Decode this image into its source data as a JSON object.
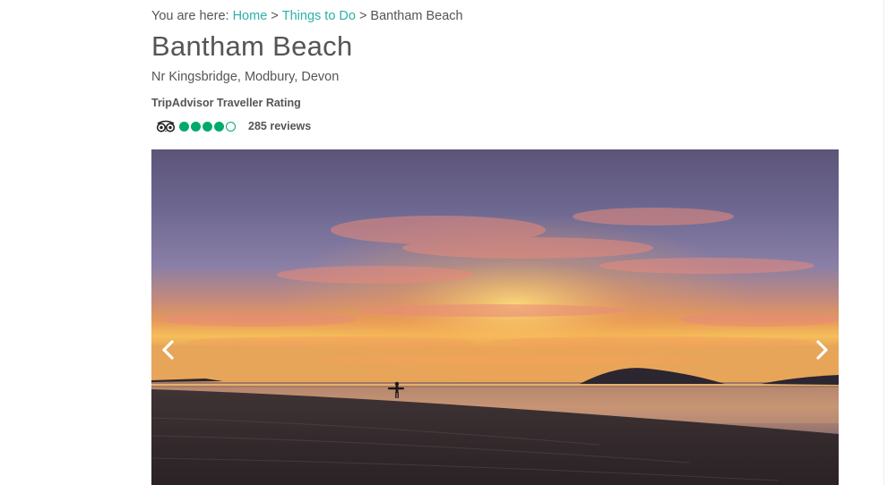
{
  "breadcrumb": {
    "prefix": "You are here:",
    "items": [
      "Home",
      "Things to Do",
      "Bantham Beach"
    ],
    "separator": ">"
  },
  "attraction": {
    "title": "Bantham Beach",
    "location": "Nr Kingsbridge, Modbury, Devon"
  },
  "rating": {
    "label": "TripAdvisor Traveller Rating",
    "provider_icon": "tripadvisor-owl-icon",
    "bubbles_filled": 4,
    "bubbles_total": 5,
    "reviews": "285 reviews"
  },
  "carousel": {
    "image": "sunset-beach-surfer-photo",
    "prev_icon": "chevron-left-icon",
    "next_icon": "chevron-right-icon"
  },
  "colors": {
    "link": "#2bb0a8",
    "text": "#555555",
    "rating_green": "#00aa6c"
  }
}
